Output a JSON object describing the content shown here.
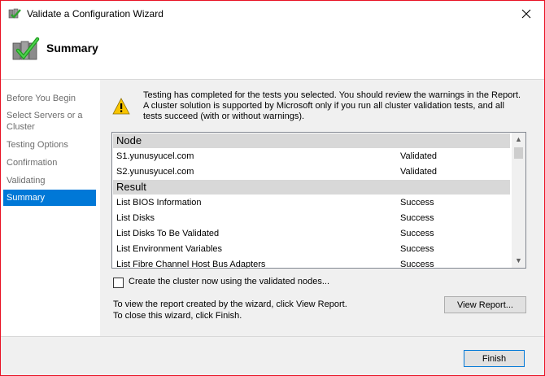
{
  "window": {
    "title": "Validate a Configuration Wizard",
    "icons": [
      "wizard-icon",
      "close-icon"
    ]
  },
  "header": {
    "title": "Summary"
  },
  "nav": {
    "items": [
      {
        "label": "Before You Begin"
      },
      {
        "label": "Select Servers or a Cluster"
      },
      {
        "label": "Testing Options"
      },
      {
        "label": "Confirmation"
      },
      {
        "label": "Validating"
      },
      {
        "label": "Summary"
      }
    ],
    "active_index": 5
  },
  "summary": {
    "message": "Testing has completed for the tests you selected. You should review the warnings in the Report.  A cluster solution is supported by Microsoft only if you run all cluster validation tests, and all tests succeed (with or without warnings).",
    "warning_icon": "warning-icon"
  },
  "results": {
    "groups": [
      {
        "title": "Node",
        "rows": [
          {
            "name": "S1.yunusyucel.com",
            "status": "Validated"
          },
          {
            "name": "S2.yunusyucel.com",
            "status": "Validated"
          }
        ]
      },
      {
        "title": "Result",
        "rows": [
          {
            "name": "List BIOS Information",
            "status": "Success"
          },
          {
            "name": "List Disks",
            "status": "Success"
          },
          {
            "name": "List Disks To Be Validated",
            "status": "Success"
          },
          {
            "name": "List Environment Variables",
            "status": "Success"
          },
          {
            "name": "List Fibre Channel Host Bus Adapters",
            "status": "Success"
          }
        ]
      }
    ]
  },
  "create_cluster": {
    "label": "Create the cluster now using the validated nodes...",
    "checked": false
  },
  "info": {
    "line1": "To view the report created by the wizard, click View Report.",
    "line2": "To close this wizard, click Finish."
  },
  "buttons": {
    "view_report": "View Report...",
    "finish": "Finish"
  },
  "colors": {
    "accent": "#0078d7",
    "window_border": "#e81123",
    "group_header": "#d8d8d8"
  }
}
